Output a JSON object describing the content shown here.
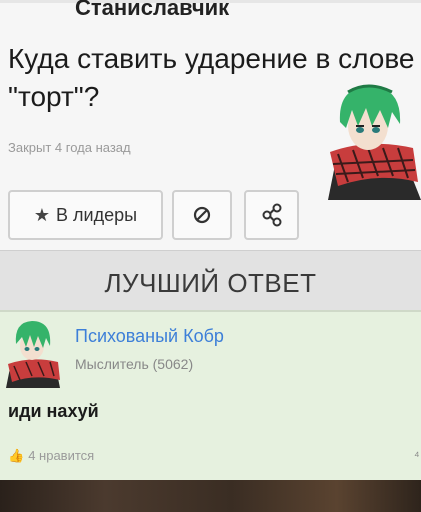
{
  "question": {
    "author": "Станиславчик",
    "title": "Куда ставить ударение в слове \"торт\"?",
    "closed_note": "Закрыт 4 года назад"
  },
  "buttons": {
    "leaders_icon": "star-icon",
    "leaders_label": "В лидеры",
    "block_icon": "block-icon",
    "share_icon": "share-icon"
  },
  "best_answer": {
    "header": "ЛУЧШИЙ ОТВЕТ",
    "author": "Психованый Кобр",
    "rank": "Мыслитель (5062)",
    "text": "иди нахуй",
    "likes": "4 нравится"
  },
  "colors": {
    "link": "#3d7fd8",
    "answer_bg": "#e6f1df"
  }
}
